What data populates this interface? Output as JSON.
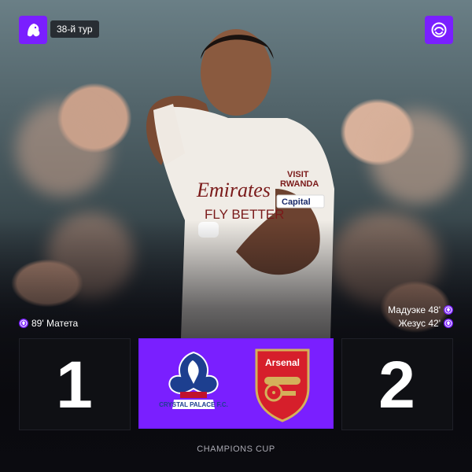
{
  "header": {
    "round_label": "38-й тур"
  },
  "scorers": {
    "home": [
      {
        "text": "89' Матета"
      }
    ],
    "away": [
      {
        "text": "Мадуэке 48'"
      },
      {
        "text": "Жезус 42'"
      }
    ]
  },
  "score": {
    "home": "1",
    "away": "2"
  },
  "teams": {
    "home_name": "CRYSTAL PALACE F.C.",
    "away_name": "Arsenal"
  },
  "player_shirt": {
    "sponsor_top": "VISIT",
    "sponsor_bottom": "RWANDA",
    "front_text_1": "Emirates",
    "front_text_2": "FLY BETTER",
    "captain_brand": "Capital"
  },
  "footer": {
    "competition": "CHAMPIONS CUP"
  },
  "colors": {
    "accent": "#7a1fff",
    "bg": "#0b0b10",
    "box": "#0f1014"
  },
  "icons": {
    "premier_league_logo": "lion-icon",
    "league_badge": "league-emblem-icon",
    "goal": "football-icon"
  }
}
